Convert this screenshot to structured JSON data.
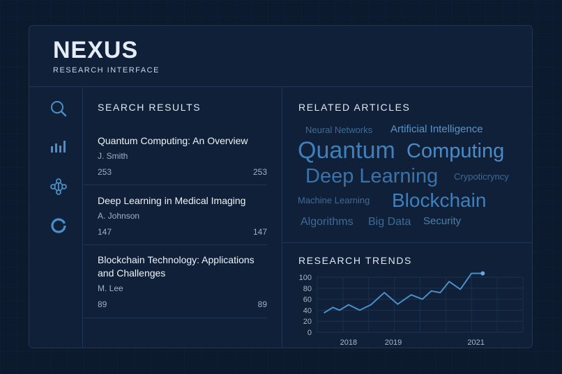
{
  "brand": {
    "title": "NEXUS",
    "subtitle": "RESEARCH INTERFACE"
  },
  "sidebar": {
    "items": [
      {
        "icon": "search-icon"
      },
      {
        "icon": "bar-chart-icon"
      },
      {
        "icon": "network-icon"
      },
      {
        "icon": "ring-icon"
      }
    ]
  },
  "search": {
    "heading": "SEARCH RESULTS",
    "results": [
      {
        "title": "Quantum Computing: An Overview",
        "author": "J. Smith",
        "count_left": "253",
        "count_right": "253"
      },
      {
        "title": "Deep Learning in Medical Imaging",
        "author": "A. Johnson",
        "count_left": "147",
        "count_right": "147"
      },
      {
        "title": "Blockchain Technology: Applications and Challenges",
        "author": "M. Lee",
        "count_left": "89",
        "count_right": "89"
      }
    ]
  },
  "related": {
    "heading": "RELATED ARTICLES",
    "words": [
      "Neural Networks",
      "Artificial Intelligence",
      "Quantum",
      "Computing",
      "Deep Learning",
      "Crypoticryncy",
      "Machine Learning",
      "Blockchain",
      "Algorithms",
      "Big Data",
      "Security"
    ]
  },
  "trends": {
    "heading": "RESEARCH TRENDS"
  },
  "colors": {
    "accent": "#4a90c8",
    "panel": "#0f2038",
    "background": "#0b1a2c"
  },
  "chart_data": {
    "type": "line",
    "title": "RESEARCH TRENDS",
    "xlabel": "",
    "ylabel": "",
    "x_ticks": [
      "2018",
      "2019",
      "2021"
    ],
    "y_ticks": [
      0,
      20,
      40,
      60,
      80,
      100
    ],
    "ylim": [
      0,
      100
    ],
    "xlim": [
      2017.4,
      2022.0
    ],
    "series": [
      {
        "x": [
          2017.55,
          2017.75,
          2017.9,
          2018.1,
          2018.35,
          2018.6,
          2018.9,
          2019.2,
          2019.5,
          2019.75,
          2019.95,
          2020.15,
          2020.35,
          2020.6,
          2020.85,
          2021.1
        ],
        "y": [
          35,
          45,
          40,
          50,
          40,
          50,
          72,
          51,
          68,
          60,
          75,
          72,
          92,
          78,
          107,
          107
        ]
      }
    ]
  }
}
